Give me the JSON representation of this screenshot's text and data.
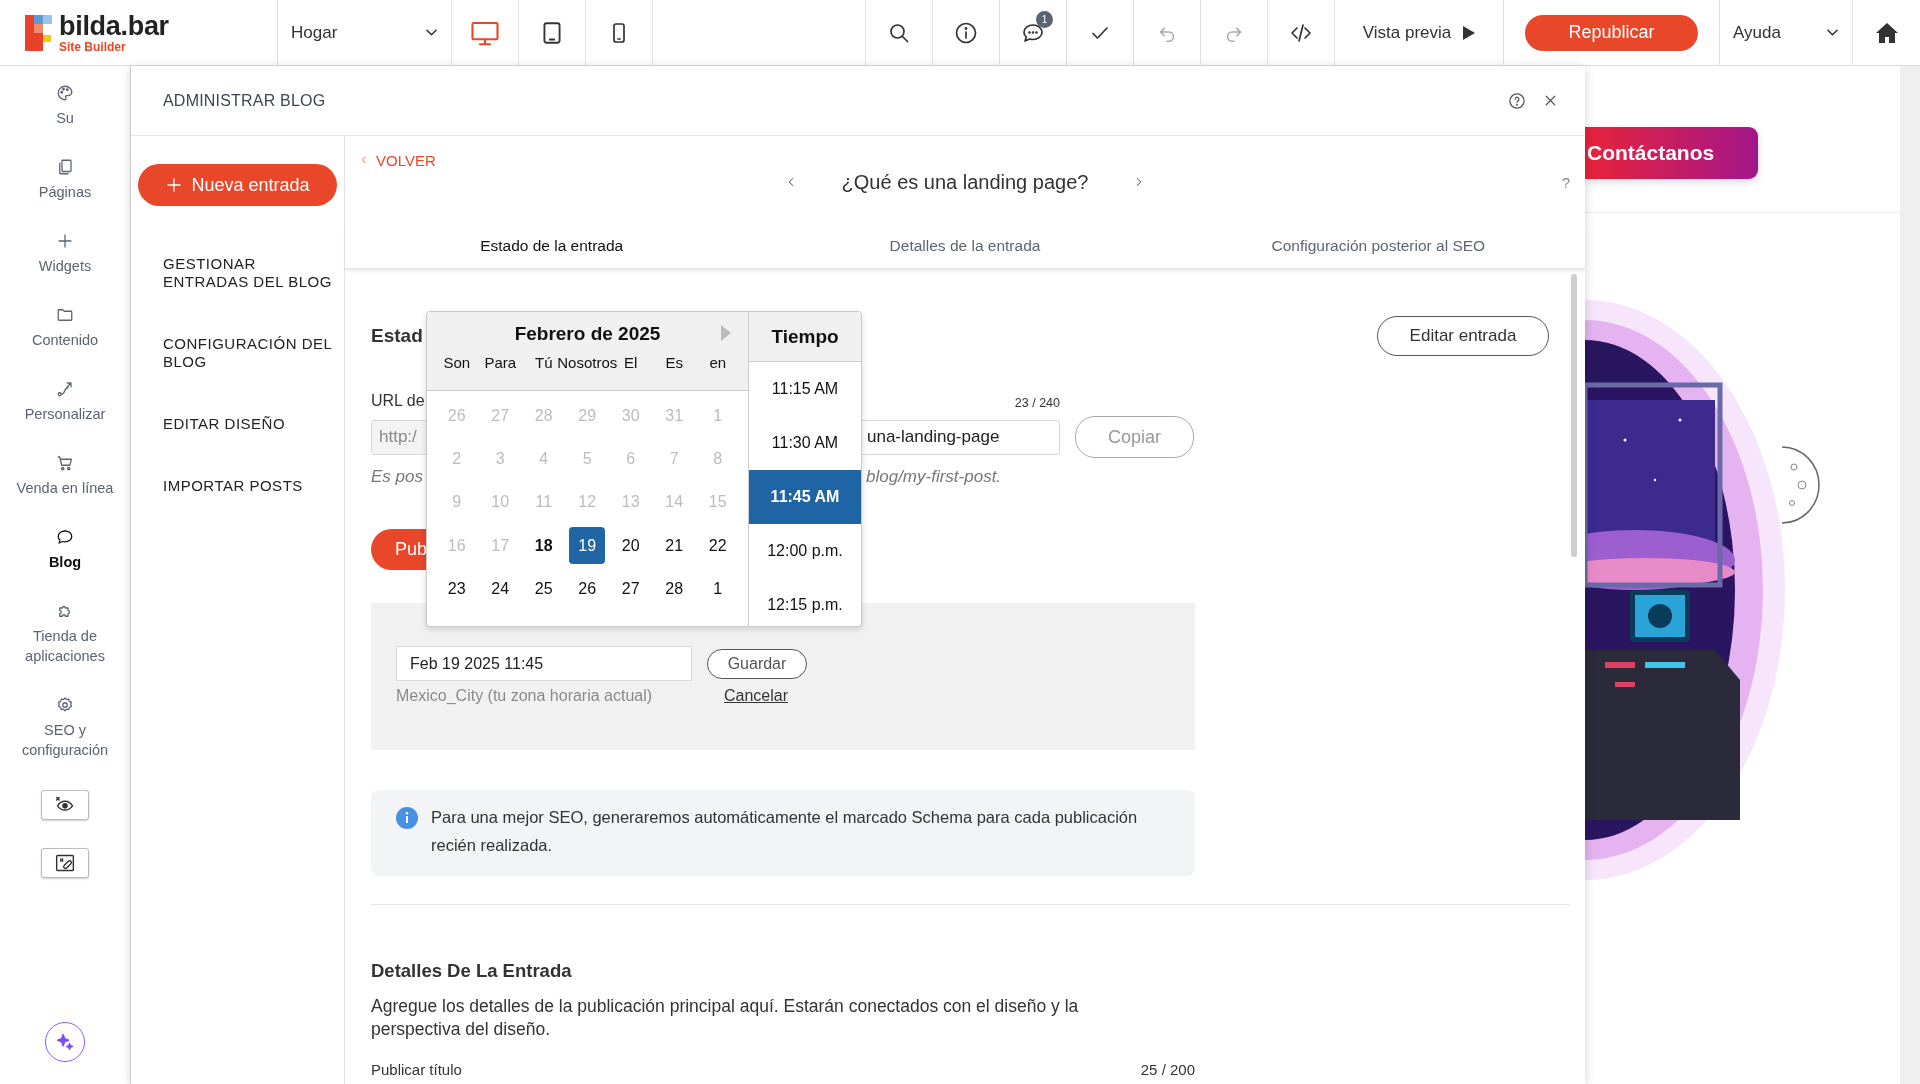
{
  "app": {
    "logo": "bilda.bar",
    "tagline": "Site Builder"
  },
  "toolbar": {
    "page": "Hogar",
    "devices": [
      {
        "kind": "desktop",
        "selected": true
      },
      {
        "kind": "tablet",
        "selected": false
      },
      {
        "kind": "phone",
        "selected": false
      }
    ],
    "comments_badge": "1",
    "preview": "Vista previa",
    "publish": "Republicar",
    "help": "Ayuda"
  },
  "sidebar": {
    "items": [
      {
        "kind": "palette",
        "label": "Su",
        "selected": false
      },
      {
        "kind": "pages",
        "label": "Páginas",
        "selected": false
      },
      {
        "kind": "plus",
        "label": "Widgets",
        "selected": false
      },
      {
        "kind": "folder",
        "label": "Contenido",
        "selected": false
      },
      {
        "kind": "route",
        "label": "Personalizar",
        "selected": false
      },
      {
        "kind": "cart",
        "label": "Venda en línea",
        "selected": false
      },
      {
        "kind": "chat",
        "label": "Blog",
        "selected": true
      },
      {
        "kind": "puzzle",
        "label": "Tienda de aplicaciones",
        "selected": false
      },
      {
        "kind": "gear",
        "label": "SEO y configuración",
        "selected": false
      }
    ]
  },
  "panel": {
    "title": "ADMINISTRAR BLOG",
    "new_button": "Nueva entrada",
    "menu": [
      "GESTIONAR ENTRADAS DEL BLOG",
      "CONFIGURACIÓN DEL BLOG",
      "EDITAR DISEÑO",
      "IMPORTAR POSTS"
    ]
  },
  "post": {
    "back": "VOLVER",
    "title": "¿Qué es una landing page?",
    "help": "?",
    "tabs": [
      {
        "label": "Estado de la entrada",
        "selected": true
      },
      {
        "label": "Detalles de la entrada",
        "selected": false
      },
      {
        "label": "Configuración posterior al SEO",
        "selected": false
      }
    ],
    "status_heading": "Estad",
    "edit_button": "Editar entrada",
    "url_label": "URL de",
    "url_counter": "23 / 240",
    "url_prefix": "http:/",
    "url_value": "una-landing-page",
    "copy_button": "Copiar",
    "hint_start": "Es pos",
    "hint_end": "blog/my-first-post.",
    "publish_button": "Pub",
    "schedule": {
      "value": "Feb 19 2025 11:45",
      "save": "Guardar",
      "timezone": "Mexico_City (tu zona horaria actual)",
      "cancel": "Cancelar"
    },
    "picker": {
      "month": "Febrero de 2025",
      "weekdays": [
        "Son",
        "Para",
        "Tú",
        "Nosotros",
        "El",
        "Es",
        "en"
      ],
      "days": [
        {
          "label": "26",
          "muted": true,
          "today": false,
          "selected": false
        },
        {
          "label": "27",
          "muted": true,
          "today": false,
          "selected": false
        },
        {
          "label": "28",
          "muted": true,
          "today": false,
          "selected": false
        },
        {
          "label": "29",
          "muted": true,
          "today": false,
          "selected": false
        },
        {
          "label": "30",
          "muted": true,
          "today": false,
          "selected": false
        },
        {
          "label": "31",
          "muted": true,
          "today": false,
          "selected": false
        },
        {
          "label": "1",
          "muted": true,
          "today": false,
          "selected": false
        },
        {
          "label": "2",
          "muted": true,
          "today": false,
          "selected": false
        },
        {
          "label": "3",
          "muted": true,
          "today": false,
          "selected": false
        },
        {
          "label": "4",
          "muted": true,
          "today": false,
          "selected": false
        },
        {
          "label": "5",
          "muted": true,
          "today": false,
          "selected": false
        },
        {
          "label": "6",
          "muted": true,
          "today": false,
          "selected": false
        },
        {
          "label": "7",
          "muted": true,
          "today": false,
          "selected": false
        },
        {
          "label": "8",
          "muted": true,
          "today": false,
          "selected": false
        },
        {
          "label": "9",
          "muted": true,
          "today": false,
          "selected": false
        },
        {
          "label": "10",
          "muted": true,
          "today": false,
          "selected": false
        },
        {
          "label": "11",
          "muted": true,
          "today": false,
          "selected": false
        },
        {
          "label": "12",
          "muted": true,
          "today": false,
          "selected": false
        },
        {
          "label": "13",
          "muted": true,
          "today": false,
          "selected": false
        },
        {
          "label": "14",
          "muted": true,
          "today": false,
          "selected": false
        },
        {
          "label": "15",
          "muted": true,
          "today": false,
          "selected": false
        },
        {
          "label": "16",
          "muted": true,
          "today": false,
          "selected": false
        },
        {
          "label": "17",
          "muted": true,
          "today": false,
          "selected": false
        },
        {
          "label": "18",
          "muted": false,
          "today": true,
          "selected": false
        },
        {
          "label": "19",
          "muted": false,
          "today": false,
          "selected": true
        },
        {
          "label": "20",
          "muted": false,
          "today": false,
          "selected": false
        },
        {
          "label": "21",
          "muted": false,
          "today": false,
          "selected": false
        },
        {
          "label": "22",
          "muted": false,
          "today": false,
          "selected": false
        },
        {
          "label": "23",
          "muted": false,
          "today": false,
          "selected": false
        },
        {
          "label": "24",
          "muted": false,
          "today": false,
          "selected": false
        },
        {
          "label": "25",
          "muted": false,
          "today": false,
          "selected": false
        },
        {
          "label": "26",
          "muted": false,
          "today": false,
          "selected": false
        },
        {
          "label": "27",
          "muted": false,
          "today": false,
          "selected": false
        },
        {
          "label": "28",
          "muted": false,
          "today": false,
          "selected": false
        },
        {
          "label": "1",
          "muted": false,
          "today": false,
          "selected": false
        }
      ],
      "time_heading": "Tiempo",
      "times": [
        {
          "label": "11:15 AM",
          "selected": false
        },
        {
          "label": "11:30 AM",
          "selected": false
        },
        {
          "label": "11:45 AM",
          "selected": true
        },
        {
          "label": "12:00 p.m.",
          "selected": false
        },
        {
          "label": "12:15 p.m.",
          "selected": false
        }
      ]
    },
    "info": "Para una mejor SEO, generaremos automáticamente el marcado Schema para cada publicación recién realizada.",
    "details_heading": "Detalles De La Entrada",
    "details_text": "Agregue los detalles de la publicación principal aquí. Estarán conectados con el diseño y la perspectiva del diseño.",
    "title_label": "Publicar título",
    "title_counter": "25 / 200"
  },
  "preview": {
    "cta": "Contáctanos"
  }
}
